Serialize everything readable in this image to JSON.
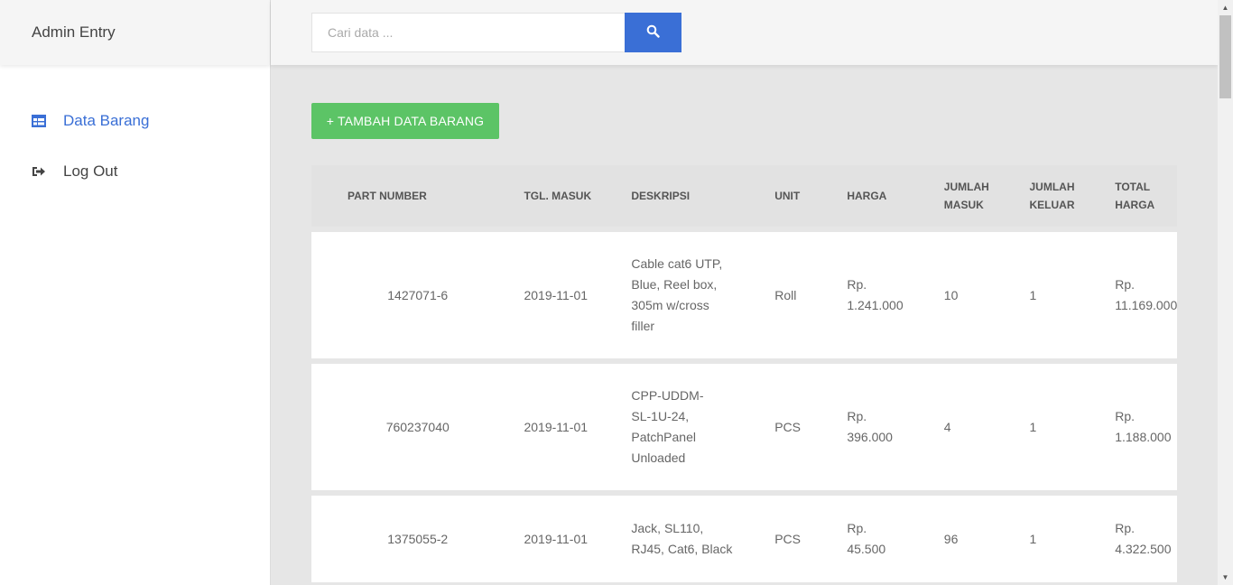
{
  "sidebar": {
    "brand": "Admin Entry",
    "items": [
      {
        "label": "Data Barang",
        "icon": "table-icon",
        "active": true
      },
      {
        "label": "Log Out",
        "icon": "sign-out-icon",
        "active": false
      }
    ]
  },
  "search": {
    "placeholder": "Cari data ...",
    "icon": "search-icon"
  },
  "toolbar": {
    "add_label": "+ TAMBAH DATA BARANG"
  },
  "table": {
    "headers": [
      "PART NUMBER",
      "TGL. MASUK",
      "DESKRIPSI",
      "UNIT",
      "HARGA",
      "JUMLAH MASUK",
      "JUMLAH KELUAR",
      "TOTAL HARGA"
    ],
    "rows": [
      {
        "part_number": "1427071-6",
        "tgl_masuk": "2019-11-01",
        "deskripsi": "Cable cat6 UTP, Blue, Reel box, 305m w/cross filler",
        "unit": "Roll",
        "harga": "Rp. 1.241.000",
        "jumlah_masuk": "10",
        "jumlah_keluar": "1",
        "total_harga": "Rp. 11.169.000"
      },
      {
        "part_number": "760237040",
        "tgl_masuk": "2019-11-01",
        "deskripsi": "CPP-UDDM-SL-1U-24, PatchPanel Unloaded",
        "unit": "PCS",
        "harga": "Rp. 396.000",
        "jumlah_masuk": "4",
        "jumlah_keluar": "1",
        "total_harga": "Rp. 1.188.000"
      },
      {
        "part_number": "1375055-2",
        "tgl_masuk": "2019-11-01",
        "deskripsi": "Jack, SL110, RJ45, Cat6, Black",
        "unit": "PCS",
        "harga": "Rp. 45.500",
        "jumlah_masuk": "96",
        "jumlah_keluar": "1",
        "total_harga": "Rp. 4.322.500"
      }
    ]
  },
  "colors": {
    "accent": "#3a6fd6",
    "add_button": "#5cc466"
  }
}
